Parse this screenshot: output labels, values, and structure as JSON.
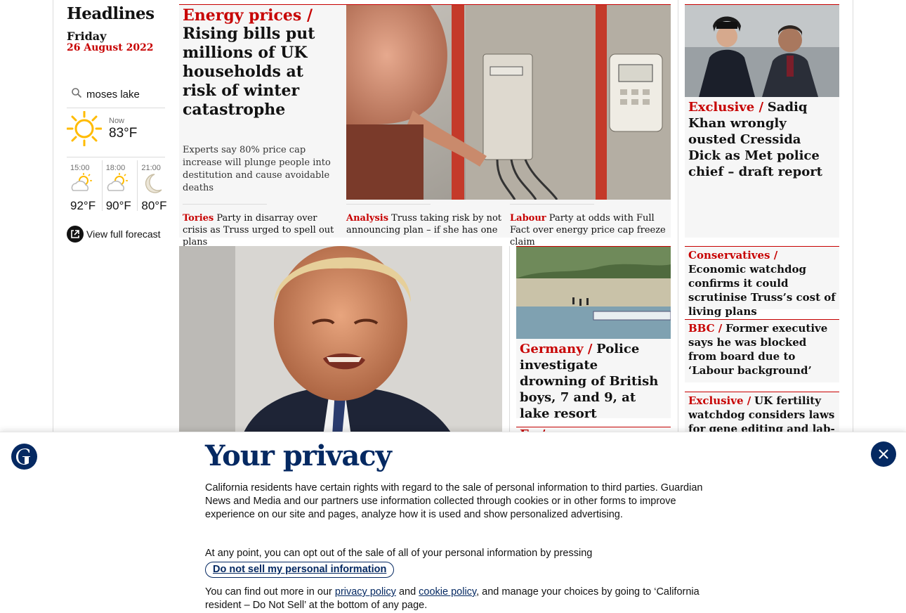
{
  "sidebar": {
    "title": "Headlines",
    "day": "Friday",
    "date": "26 August 2022",
    "weather": {
      "location": "moses lake",
      "now_label": "Now",
      "now_temp": "83°F",
      "forecast": [
        {
          "time": "15:00",
          "temp": "92°F",
          "icon": "partly-cloudy-icon"
        },
        {
          "time": "18:00",
          "temp": "90°F",
          "icon": "partly-cloudy-icon"
        },
        {
          "time": "21:00",
          "temp": "80°F",
          "icon": "moon-icon"
        }
      ],
      "full_forecast_label": "View full forecast"
    }
  },
  "top_story": {
    "kicker": "Energy prices /",
    "headline": "Rising bills put millions of UK households at risk of winter catastrophe",
    "standfirst": "Experts say 80% price cap increase will plunge people into destitution and cause avoidable deaths",
    "sublinks": [
      {
        "kicker": "Tories",
        "text": "Party in disarray over crisis as Truss urged to spell out plans"
      },
      {
        "kicker": "Analysis",
        "text": "Truss taking risk by not announcing plan – if she has one"
      },
      {
        "kicker": "Labour",
        "text": "Party at odds with Full Fact over energy price cap freeze claim"
      }
    ]
  },
  "right_column": {
    "sadiq": {
      "kicker": "Exclusive /",
      "headline": "Sadiq Khan wrongly ousted Cressida Dick as Met police chief – draft report"
    },
    "items": [
      {
        "kicker": "Conservatives /",
        "headline": "Economic watchdog confirms it could scrutinise Truss’s cost of living plans"
      },
      {
        "kicker": "BBC /",
        "headline": "Former executive says he was blocked from board due to ‘Labour background’"
      },
      {
        "kicker": "Exclusive /",
        "headline": "UK fertility watchdog considers laws for gene editing and lab-"
      }
    ]
  },
  "germany": {
    "kicker": "Germany /",
    "headline": "Police investigate drowning of British boys, 7 and 9, at lake resort"
  },
  "peek": {
    "kicker": "Fa             /"
  },
  "privacy": {
    "title": "Your privacy",
    "body": "California residents have certain rights with regard to the sale of personal information to third parties. Guardian News and Media and our partners use information collected through cookies or in other forms to improve experience on our site and pages, analyze how it is used and show personalized advertising.",
    "optout": "At any point, you can opt out of the sale of all of your personal information by pressing",
    "button": "Do not sell my personal information",
    "more_prefix": "You can find out more in our",
    "privacy_link": "privacy policy",
    "and": "and",
    "cookie_link": "cookie policy",
    "more_suffix": ", and manage your choices by going to ‘California resident – Do Not Sell’ at the bottom of any page."
  },
  "colors": {
    "news_red": "#c70000",
    "brand_blue": "#052962",
    "card_bg": "#f6f6f6"
  }
}
